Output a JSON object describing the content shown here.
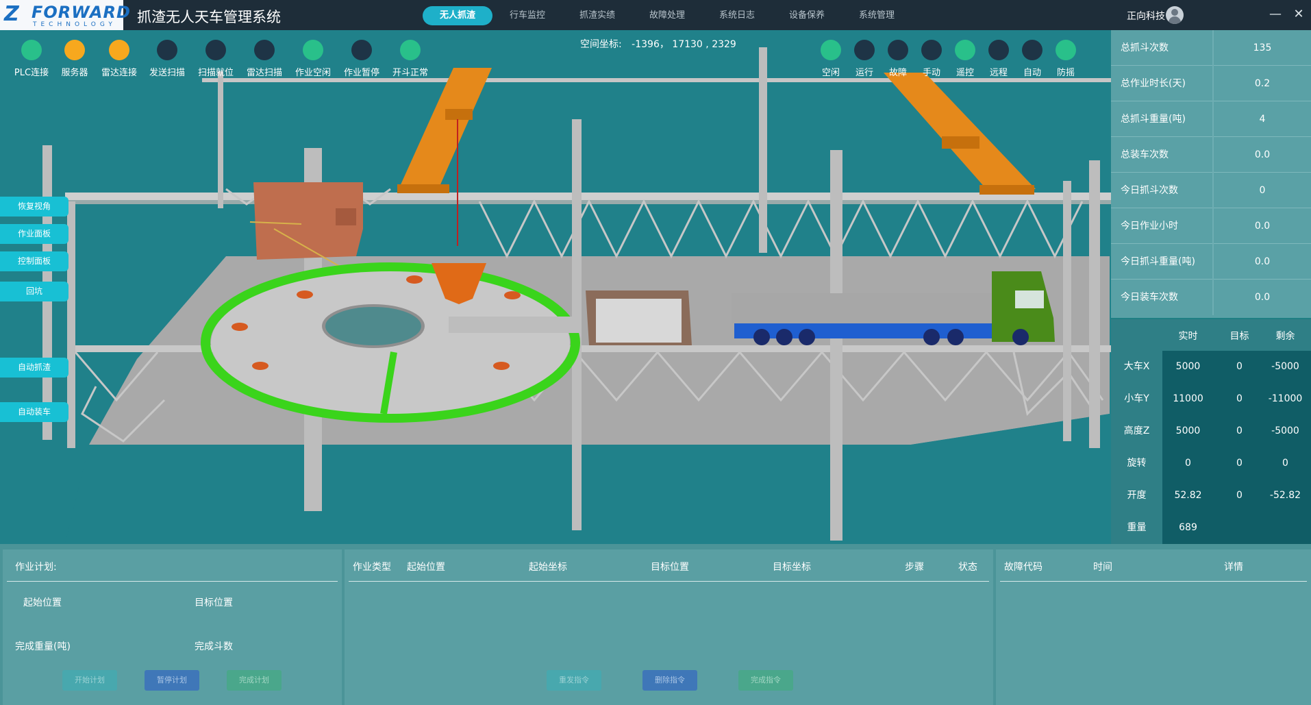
{
  "header": {
    "logo_mark": "Z",
    "logo_brand": "FORWARD",
    "logo_sub": "TECHNOLOGY",
    "title": "抓渣无人天车管理系统",
    "tabs": [
      {
        "label": "无人抓渣",
        "active": true
      },
      {
        "label": "行车监控"
      },
      {
        "label": "抓渣实绩"
      },
      {
        "label": "故障处理"
      },
      {
        "label": "系统日志"
      },
      {
        "label": "设备保养"
      },
      {
        "label": "系统管理"
      }
    ],
    "company": "正向科技",
    "minimize": "—",
    "close": "✕"
  },
  "colors": {
    "green": "#29c08a",
    "orange": "#f7a81e",
    "dark": "#1e3446",
    "accent": "#1eb0c9"
  },
  "left_indicators": [
    {
      "label": "PLC连接",
      "state": "green"
    },
    {
      "label": "服务器",
      "state": "orange"
    },
    {
      "label": "雷达连接",
      "state": "orange"
    },
    {
      "label": "发送扫描",
      "state": "dark"
    },
    {
      "label": "扫描就位",
      "state": "dark"
    },
    {
      "label": "雷达扫描",
      "state": "dark"
    },
    {
      "label": "作业空闲",
      "state": "green"
    },
    {
      "label": "作业暂停",
      "state": "dark"
    },
    {
      "label": "开斗正常",
      "state": "green"
    }
  ],
  "right_indicators": [
    {
      "label": "空闲",
      "state": "green"
    },
    {
      "label": "运行",
      "state": "dark"
    },
    {
      "label": "故障",
      "state": "dark"
    },
    {
      "label": "手动",
      "state": "dark"
    },
    {
      "label": "遥控",
      "state": "green"
    },
    {
      "label": "远程",
      "state": "dark"
    },
    {
      "label": "自动",
      "state": "dark"
    },
    {
      "label": "防摇",
      "state": "green"
    }
  ],
  "coords": {
    "label": "空间坐标:",
    "value": "-1396， 17130 , 2329"
  },
  "side_buttons": [
    "恢复视角",
    "作业面板",
    "控制面板",
    "回坑",
    "自动抓渣",
    "自动装车"
  ],
  "stats": [
    {
      "label": "总抓斗次数",
      "value": "135"
    },
    {
      "label": "总作业时长(天)",
      "value": "0.2"
    },
    {
      "label": "总抓斗重量(吨)",
      "value": "4"
    },
    {
      "label": "总装车次数",
      "value": "0.0"
    },
    {
      "label": "今日抓斗次数",
      "value": "0"
    },
    {
      "label": "今日作业小时",
      "value": "0.0"
    },
    {
      "label": "今日抓斗重量(吨)",
      "value": "0.0"
    },
    {
      "label": "今日装车次数",
      "value": "0.0"
    }
  ],
  "axes": {
    "headers": [
      "实时",
      "目标",
      "剩余"
    ],
    "rows": [
      {
        "name": "大车X",
        "realtime": "5000",
        "target": "0",
        "remaining": "-5000"
      },
      {
        "name": "小车Y",
        "realtime": "11000",
        "target": "0",
        "remaining": "-11000"
      },
      {
        "name": "高度Z",
        "realtime": "5000",
        "target": "0",
        "remaining": "-5000"
      },
      {
        "name": "旋转",
        "realtime": "0",
        "target": "0",
        "remaining": "0"
      },
      {
        "name": "开度",
        "realtime": "52.82",
        "target": "0",
        "remaining": "-52.82"
      },
      {
        "name": "重量",
        "realtime": "689",
        "target": "",
        "remaining": ""
      }
    ]
  },
  "plan": {
    "title": "作业计划:",
    "start_pos": "起始位置",
    "target_pos": "目标位置",
    "done_weight": "完成重量(吨)",
    "done_buckets": "完成斗数",
    "buttons": [
      "开始计划",
      "暂停计划",
      "完成计划"
    ]
  },
  "commands": {
    "columns": [
      "作业类型",
      "起始位置",
      "起始坐标",
      "目标位置",
      "目标坐标",
      "步骤",
      "状态"
    ],
    "buttons": [
      "重发指令",
      "删除指令",
      "完成指令"
    ]
  },
  "faults": {
    "columns": [
      "故障代码",
      "时间",
      "详情"
    ]
  }
}
